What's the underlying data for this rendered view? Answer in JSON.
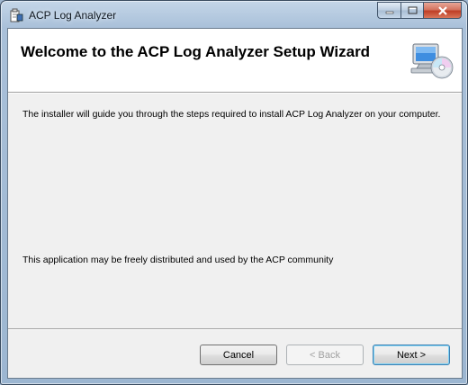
{
  "window": {
    "title": "ACP Log Analyzer"
  },
  "banner": {
    "title": "Welcome to the ACP Log Analyzer Setup Wizard",
    "icon": "computer-cd-icon"
  },
  "content": {
    "intro": "The installer will guide you through the steps required to install ACP Log Analyzer on your computer.",
    "distribution": "This application may be freely distributed and used by the ACP community"
  },
  "buttons": {
    "cancel": "Cancel",
    "back": "< Back",
    "next": "Next >"
  },
  "colors": {
    "client_bg": "#f0f0f0",
    "banner_bg": "#ffffff",
    "close_button": "#c94a30"
  }
}
